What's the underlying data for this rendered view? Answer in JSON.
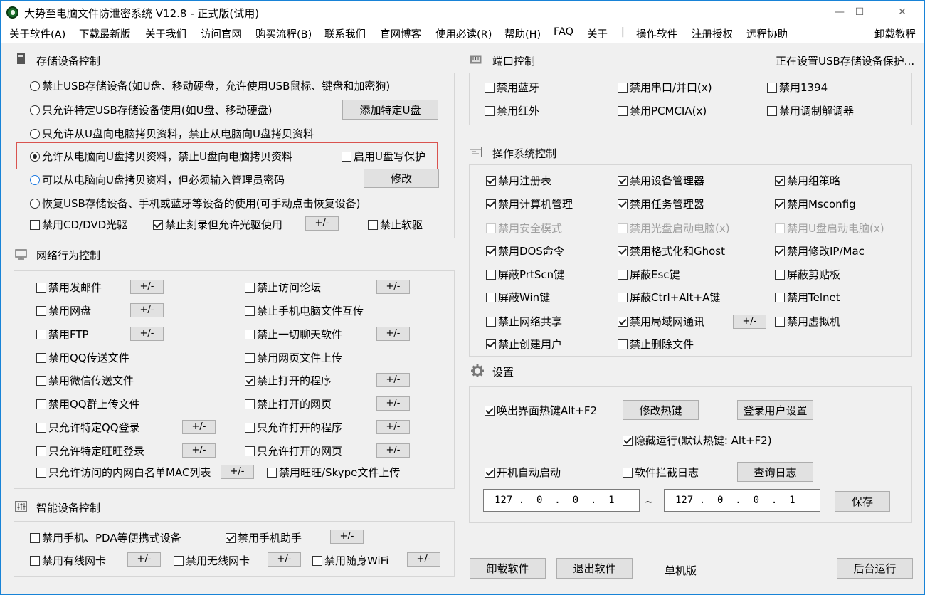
{
  "window": {
    "title": "大势至电脑文件防泄密系统 V12.8 - 正式版(试用)",
    "min": "—",
    "max": "☐",
    "close": "✕"
  },
  "menu": [
    "关于软件(A)",
    "下载最新版",
    "关于我们",
    "访问官网",
    "购买流程(B)",
    "联系我们",
    "官网博客",
    "使用必读(R)",
    "帮助(H)",
    "FAQ",
    "关于",
    "|",
    "操作软件",
    "注册授权",
    "远程协助",
    "卸载教程"
  ],
  "storage": {
    "title": "存储设备控制",
    "options": [
      "禁止USB存储设备(如U盘、移动硬盘，允许使用USB鼠标、键盘和加密狗)",
      "只允许特定USB存储设备使用(如U盘、移动硬盘)",
      "只允许从U盘向电脑拷贝资料，禁止从电脑向U盘拷贝资料",
      "允许从电脑向U盘拷贝资料，禁止U盘向电脑拷贝资料",
      "可以从电脑向U盘拷贝资料，但必须输入管理员密码",
      "恢复USB存储设备、手机或蓝牙等设备的使用(可手动点击恢复设备)"
    ],
    "selected_index": 3,
    "add_btn": "添加特定U盘",
    "write_protect": "启用U盘写保护",
    "modify_btn": "修改",
    "cd": "禁用CD/DVD光驱",
    "burn": "禁止刻录但允许光驱使用",
    "floppy": "禁止软驱",
    "pm": "+/-"
  },
  "network": {
    "title": "网络行为控制",
    "left": [
      "禁用发邮件",
      "禁用网盘",
      "禁用FTP",
      "禁用QQ传送文件",
      "禁用微信传送文件",
      "禁用QQ群上传文件",
      "只允许特定QQ登录",
      "只允许特定旺旺登录"
    ],
    "right": [
      "禁止访问论坛",
      "禁止手机电脑文件互传",
      "禁止一切聊天软件",
      "禁用网页文件上传",
      "禁止打开的程序",
      "禁止打开的网页",
      "只允许打开的程序",
      "只允许打开的网页"
    ],
    "mac": "只允许访问的内网白名单MAC列表",
    "wangwang": "禁用旺旺/Skype文件上传"
  },
  "smart": {
    "title": "智能设备控制",
    "pda": "禁用手机、PDA等便携式设备",
    "assistant": "禁用手机助手",
    "wired": "禁用有线网卡",
    "wireless": "禁用无线网卡",
    "wifi": "禁用随身WiFi"
  },
  "port": {
    "title": "端口控制",
    "status": "正在设置USB存储设备保护...",
    "items": [
      "禁用蓝牙",
      "禁用串口/并口(x)",
      "禁用1394",
      "禁用红外",
      "禁用PCMCIA(x)",
      "禁用调制解调器"
    ]
  },
  "os": {
    "title": "操作系统控制",
    "items": [
      "禁用注册表",
      "禁用设备管理器",
      "禁用组策略",
      "禁用计算机管理",
      "禁用任务管理器",
      "禁用Msconfig",
      "禁用安全模式",
      "禁用光盘启动电脑(x)",
      "禁用U盘启动电脑(x)",
      "禁用DOS命令",
      "禁用格式化和Ghost",
      "禁用修改IP/Mac",
      "屏蔽PrtScn键",
      "屏蔽Esc键",
      "屏蔽剪贴板",
      "屏蔽Win键",
      "屏蔽Ctrl+Alt+A键",
      "禁用Telnet",
      "禁止网络共享",
      "禁用局域网通讯",
      "禁用虚拟机",
      "禁止创建用户",
      "禁止删除文件"
    ]
  },
  "settings": {
    "title": "设置",
    "hotkey": "唤出界面热键Alt+F2",
    "modify_hotkey": "修改热键",
    "login_settings": "登录用户设置",
    "hidden_run": "隐藏运行(默认热键: Alt+F2)",
    "autostart": "开机自动启动",
    "intercept_log": "软件拦截日志",
    "query_log": "查询日志",
    "ip_from": "127 .  0  .  0  .  1",
    "tilde": "~",
    "ip_to": "127 .  0  .  0  .  1",
    "save": "保存"
  },
  "bottom": {
    "uninstall": "卸载软件",
    "exit": "退出软件",
    "edition": "单机版",
    "background": "后台运行"
  }
}
